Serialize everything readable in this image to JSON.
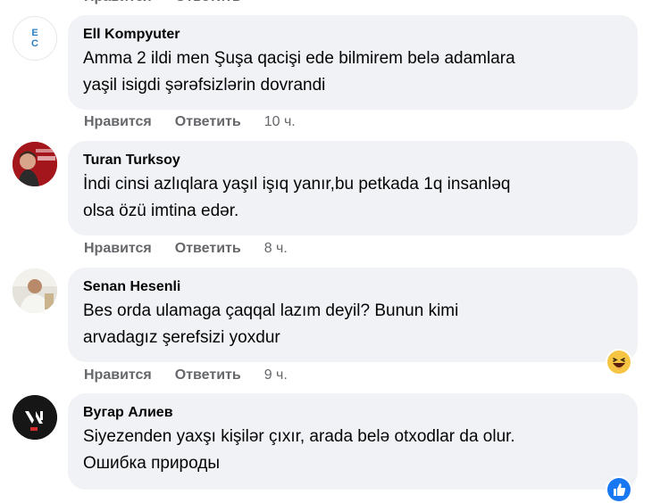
{
  "top": {
    "like": "Нравится",
    "reply": "Ответить"
  },
  "comments": [
    {
      "author": "Ell Kompyuter",
      "text_lines": [
        "Amma 2 ildi men Şuşa qacişi ede bilmirem belə adamlara",
        "yaşil isigdi şərəfsizlərin dovrandi"
      ],
      "like": "Нравится",
      "reply": "Ответить",
      "time": "10 ч.",
      "avatar_text": [
        "E",
        "C"
      ]
    },
    {
      "author": "Turan Turksoy",
      "text_lines": [
        "İndi cinsi azlıqlara yaşıl işıq yanır,bu petkada 1q insanləq",
        "olsa özü imtina edər."
      ],
      "like": "Нравится",
      "reply": "Ответить",
      "time": "8 ч."
    },
    {
      "author": "Senan Hesenli",
      "text_lines": [
        "Bes orda ulamaga çaqqal lazım deyil? Bunun kimi",
        "arvadagız şerefsizi yoxdur"
      ],
      "like": "Нравится",
      "reply": "Ответить",
      "time": "9 ч."
    },
    {
      "author": "Вугар Алиев",
      "text_lines": [
        "Siyezenden yaxşı kişilər çıxır, arada belə otxodlar da olur.",
        "Ошибка природы"
      ]
    }
  ],
  "colors": {
    "bubble": "#f0f2f5",
    "meta": "#65676b",
    "text": "#050505",
    "like_blue": "#1877f2",
    "haha_yellow": "#f7c544"
  }
}
